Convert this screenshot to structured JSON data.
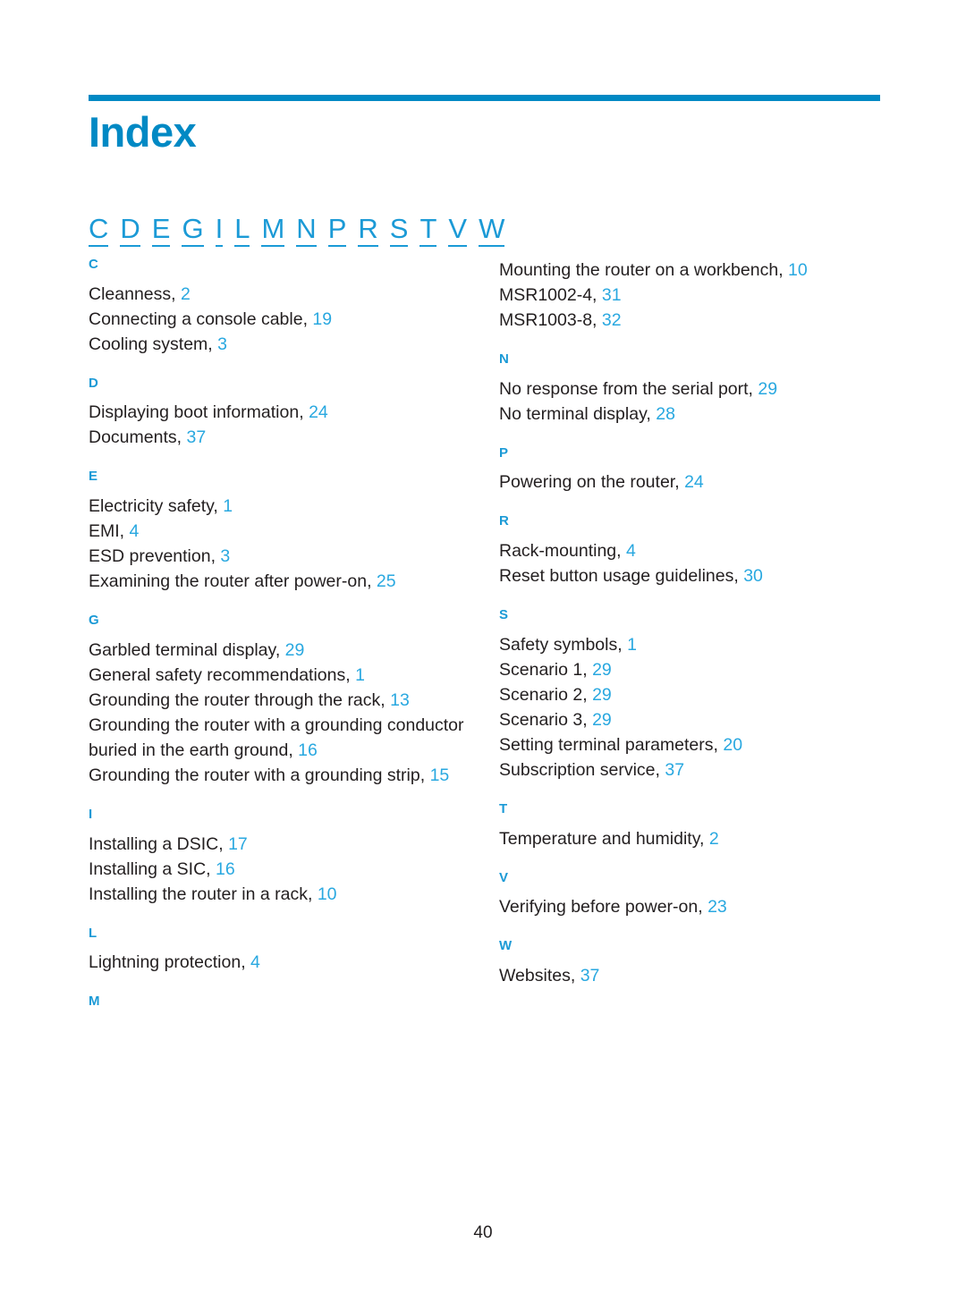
{
  "header": {
    "title": "Index",
    "rule_color": "#0089c4",
    "title_color": "#0089c4"
  },
  "alpha_nav": {
    "link_color": "#29a8e0",
    "letters": [
      "C",
      "D",
      "E",
      "G",
      "I",
      "L",
      "M",
      "N",
      "P",
      "R",
      "S",
      "T",
      "V",
      "W"
    ]
  },
  "colors": {
    "heading_blue": "#1b9ad6",
    "page_number_blue": "#29a8e0",
    "body_text": "#231f20"
  },
  "left_column": {
    "sections": [
      {
        "letter": "C",
        "entries": [
          {
            "text": "Cleanness,",
            "page": "2"
          },
          {
            "text": "Connecting a console cable,",
            "page": "19"
          },
          {
            "text": "Cooling system,",
            "page": "3"
          }
        ]
      },
      {
        "letter": "D",
        "entries": [
          {
            "text": "Displaying boot information,",
            "page": "24"
          },
          {
            "text": "Documents,",
            "page": "37"
          }
        ]
      },
      {
        "letter": "E",
        "entries": [
          {
            "text": "Electricity safety,",
            "page": "1"
          },
          {
            "text": "EMI,",
            "page": "4"
          },
          {
            "text": "ESD prevention,",
            "page": "3"
          },
          {
            "text": "Examining the router after power-on,",
            "page": "25"
          }
        ]
      },
      {
        "letter": "G",
        "entries": [
          {
            "text": "Garbled terminal display,",
            "page": "29"
          },
          {
            "text": "General safety recommendations,",
            "page": "1"
          },
          {
            "text": "Grounding the router through the rack,",
            "page": "13"
          },
          {
            "text": "Grounding the router with a grounding conductor buried in the earth ground,",
            "page": "16"
          },
          {
            "text": "Grounding the router with a grounding strip,",
            "page": "15"
          }
        ]
      },
      {
        "letter": "I",
        "entries": [
          {
            "text": "Installing a DSIC,",
            "page": "17"
          },
          {
            "text": "Installing a SIC,",
            "page": "16"
          },
          {
            "text": "Installing the router in a rack,",
            "page": "10"
          }
        ]
      },
      {
        "letter": "L",
        "entries": [
          {
            "text": "Lightning protection,",
            "page": "4"
          }
        ]
      },
      {
        "letter": "M",
        "entries": []
      }
    ]
  },
  "right_column": {
    "continued_entries": [
      {
        "text": "Mounting the router on a workbench,",
        "page": "10"
      },
      {
        "text": "MSR1002-4,",
        "page": "31"
      },
      {
        "text": "MSR1003-8,",
        "page": "32"
      }
    ],
    "sections": [
      {
        "letter": "N",
        "entries": [
          {
            "text": "No response from the serial port,",
            "page": "29"
          },
          {
            "text": "No terminal display,",
            "page": "28"
          }
        ]
      },
      {
        "letter": "P",
        "entries": [
          {
            "text": "Powering on the router,",
            "page": "24"
          }
        ]
      },
      {
        "letter": "R",
        "entries": [
          {
            "text": "Rack-mounting,",
            "page": "4"
          },
          {
            "text": "Reset button usage guidelines,",
            "page": "30"
          }
        ]
      },
      {
        "letter": "S",
        "entries": [
          {
            "text": "Safety symbols,",
            "page": "1"
          },
          {
            "text": "Scenario 1,",
            "page": "29"
          },
          {
            "text": "Scenario 2,",
            "page": "29"
          },
          {
            "text": "Scenario 3,",
            "page": "29"
          },
          {
            "text": "Setting terminal parameters,",
            "page": "20"
          },
          {
            "text": "Subscription service,",
            "page": "37"
          }
        ]
      },
      {
        "letter": "T",
        "entries": [
          {
            "text": "Temperature and humidity,",
            "page": "2"
          }
        ]
      },
      {
        "letter": "V",
        "entries": [
          {
            "text": "Verifying before power-on,",
            "page": "23"
          }
        ]
      },
      {
        "letter": "W",
        "entries": [
          {
            "text": "Websites,",
            "page": "37"
          }
        ]
      }
    ]
  },
  "footer": {
    "page_number": "40"
  }
}
